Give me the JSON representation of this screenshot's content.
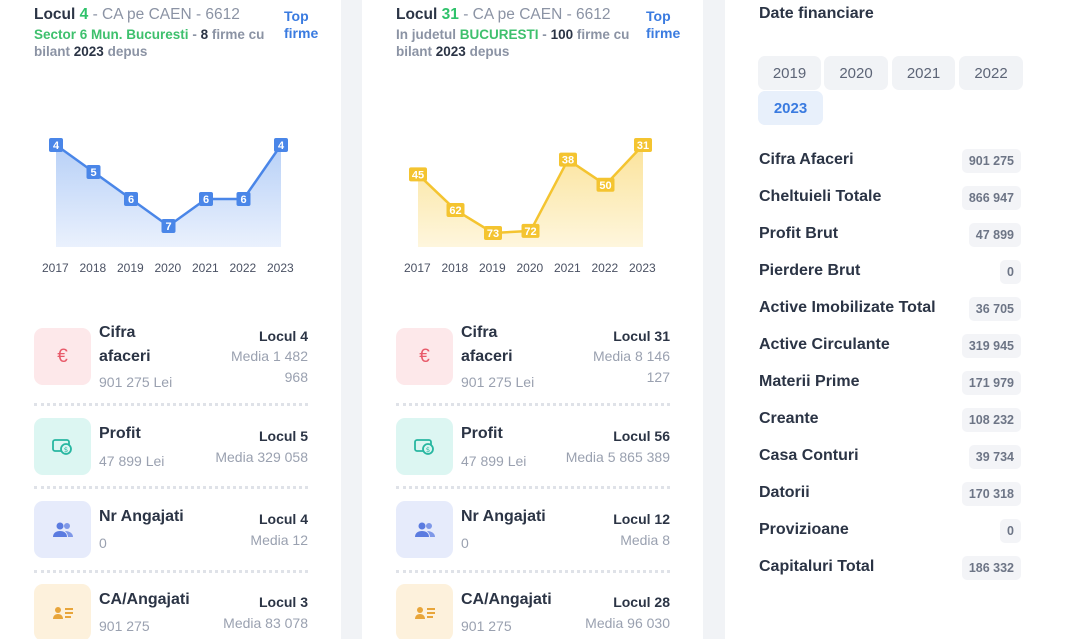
{
  "panel1": {
    "title_prefix": "Locul",
    "rank": "4",
    "title_rest": "- CA pe CAEN - 6612",
    "top_link_1": "Top",
    "top_link_2": "firme",
    "sub_area": "Sector 6 Mun. Bucuresti",
    "sub_dash": "-",
    "sub_count": "8",
    "sub_firms": "firme cu",
    "sub_bilant": "bilant",
    "sub_year": "2023",
    "sub_depuis": "depus",
    "chart_data": {
      "type": "line",
      "x": [
        "2017",
        "2018",
        "2019",
        "2020",
        "2021",
        "2022",
        "2023"
      ],
      "values": [
        4,
        5,
        6,
        7,
        6,
        6,
        4
      ],
      "color": "#4a86e8"
    },
    "metrics": [
      {
        "name_1": "Cifra",
        "name_2": "afaceri",
        "value": "901 275 Lei",
        "rank": "Locul 4",
        "media_1": "Media 1 482",
        "media_2": "968",
        "icon": "euro-icon"
      },
      {
        "name": "Profit",
        "value": "47 899 Lei",
        "rank": "Locul 5",
        "media": "Media 329 058",
        "icon": "money-icon"
      },
      {
        "name": "Nr Angajati",
        "value": "0",
        "rank": "Locul 4",
        "media": "Media 12",
        "icon": "users-icon"
      },
      {
        "name": "CA/Angajati",
        "value": "901 275",
        "rank": "Locul 3",
        "media": "Media 83 078",
        "icon": "id-card-icon"
      }
    ]
  },
  "panel2": {
    "title_prefix": "Locul",
    "rank": "31",
    "title_rest": "- CA pe CAEN - 6612",
    "top_link_1": "Top",
    "top_link_2": "firme",
    "sub_area_prefix": "In judetul",
    "sub_area": "BUCURESTI",
    "sub_dash": "-",
    "sub_count": "100",
    "sub_firms": "firme cu",
    "sub_bilant": "bilant",
    "sub_year": "2023",
    "sub_depuis": "depus",
    "chart_data": {
      "type": "line",
      "x": [
        "2017",
        "2018",
        "2019",
        "2020",
        "2021",
        "2022",
        "2023"
      ],
      "values": [
        45,
        62,
        73,
        72,
        38,
        50,
        31
      ],
      "color": "#f4c430"
    },
    "metrics": [
      {
        "name_1": "Cifra",
        "name_2": "afaceri",
        "value": "901 275 Lei",
        "rank": "Locul 31",
        "media_1": "Media 8 146",
        "media_2": "127",
        "icon": "euro-icon"
      },
      {
        "name": "Profit",
        "value": "47 899 Lei",
        "rank": "Locul 56",
        "media": "Media 5 865 389",
        "icon": "money-icon"
      },
      {
        "name": "Nr Angajati",
        "value": "0",
        "rank": "Locul 12",
        "media": "Media 8",
        "icon": "users-icon"
      },
      {
        "name": "CA/Angajati",
        "value": "901 275",
        "rank": "Locul 28",
        "media": "Media 96 030",
        "icon": "id-card-icon"
      }
    ]
  },
  "financial": {
    "title": "Date financiare",
    "years": [
      "2019",
      "2020",
      "2021",
      "2022",
      "2023"
    ],
    "active_year": "2023",
    "rows": [
      {
        "label": "Cifra Afaceri",
        "value": "901 275"
      },
      {
        "label": "Cheltuieli Totale",
        "value": "866 947"
      },
      {
        "label": "Profit Brut",
        "value": "47 899"
      },
      {
        "label": "Pierdere Brut",
        "value": "0"
      },
      {
        "label": "Active Imobilizate Total",
        "value": "36 705"
      },
      {
        "label": "Active Circulante",
        "value": "319 945"
      },
      {
        "label": "Materii Prime",
        "value": "171 979"
      },
      {
        "label": "Creante",
        "value": "108 232"
      },
      {
        "label": "Casa Conturi",
        "value": "39 734"
      },
      {
        "label": "Datorii",
        "value": "170 318"
      },
      {
        "label": "Provizioane",
        "value": "0"
      },
      {
        "label": "Capitaluri Total",
        "value": "186 332"
      }
    ]
  },
  "colors": {
    "accent_blue": "#3a7be0",
    "accent_green": "#2fc26b",
    "chart_blue": "#4a86e8",
    "chart_yellow": "#f4c430"
  }
}
